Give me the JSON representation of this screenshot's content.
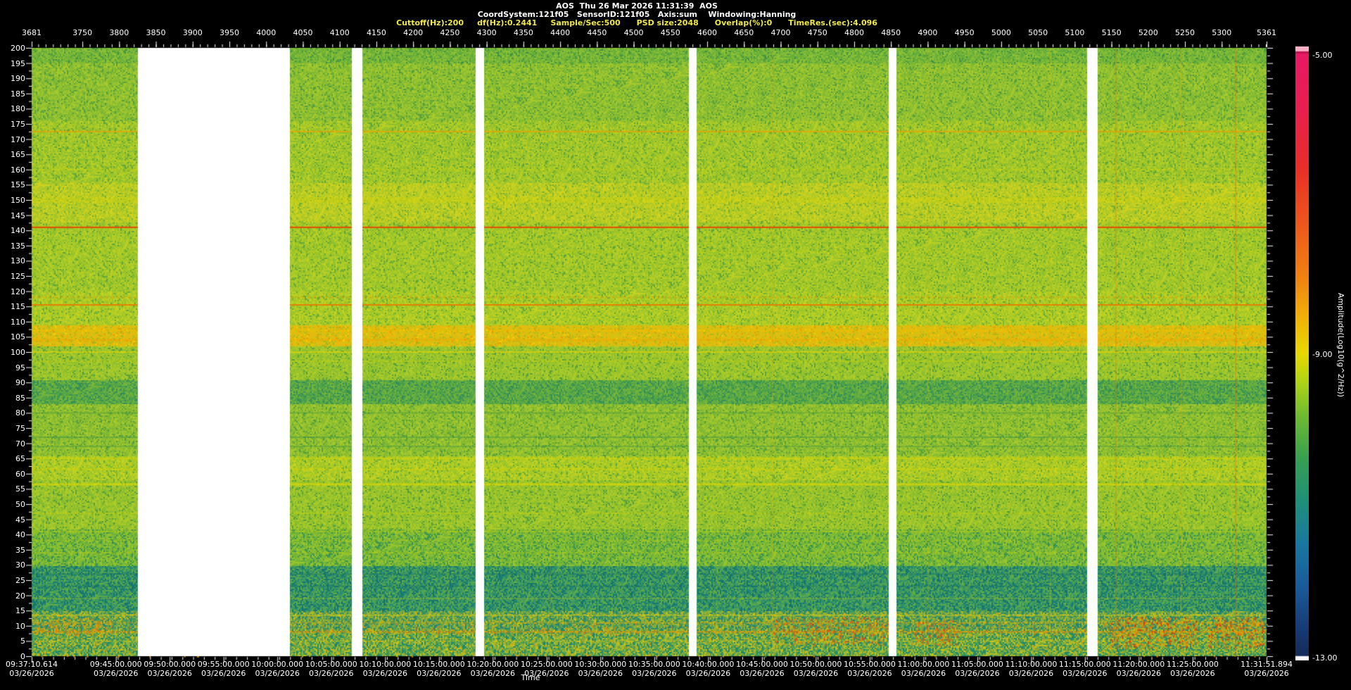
{
  "header": {
    "line1": "AOS  Thu 26 Mar 2026 11:31:39  AOS",
    "line2": "CoordSystem:121f05   SensorID:121f05   Axis:sum    Windowing:Hanning",
    "line3": "Cuttoff(Hz):200     df(Hz):0.2441     Sample/Sec:500      PSD size:2048      Overlap(%):0      TimeRes.(sec):4.096",
    "line3_color": "#f0e84a"
  },
  "chart_data": {
    "type": "heatmap",
    "subtype": "spectrogram",
    "title": "AOS  Thu 26 Mar 2026 11:31:39  AOS",
    "top_axis": {
      "range": [
        3681,
        5361
      ],
      "labels": [
        3681,
        3750,
        3800,
        3850,
        3900,
        3950,
        4000,
        4050,
        4100,
        4150,
        4200,
        4250,
        4300,
        4350,
        4400,
        4450,
        4500,
        4550,
        4600,
        4650,
        4700,
        4750,
        4800,
        4850,
        4900,
        4950,
        5000,
        5050,
        5100,
        5150,
        5200,
        5250,
        5300,
        5361
      ],
      "minor_tick_step": 10,
      "major_tick_step": 50
    },
    "y_axis": {
      "range": [
        0,
        200
      ],
      "labels": [
        200,
        195,
        190,
        185,
        180,
        175,
        170,
        165,
        160,
        155,
        150,
        145,
        140,
        135,
        130,
        125,
        120,
        115,
        110,
        105,
        100,
        95,
        90,
        85,
        80,
        75,
        70,
        65,
        60,
        55,
        50,
        45,
        40,
        35,
        30,
        25,
        20,
        15,
        10,
        5,
        0
      ],
      "minor_tick_step": 2.5,
      "major_tick_step": 5
    },
    "time_axis": {
      "title": "Time",
      "start": "09:37:10.614",
      "end": "11:31:51.894",
      "total_seconds": 6881.28,
      "labels": [
        {
          "time": "09:37:10.614",
          "date": "03/26/2026",
          "pos": 0
        },
        {
          "time": "09:45:00.000",
          "date": "03/26/2026",
          "pos": 0.0682
        },
        {
          "time": "09:50:00.000",
          "date": "03/26/2026",
          "pos": 0.1118
        },
        {
          "time": "09:55:00.000",
          "date": "03/26/2026",
          "pos": 0.1554
        },
        {
          "time": "10:00:00.000",
          "date": "03/26/2026",
          "pos": 0.199
        },
        {
          "time": "10:05:00.000",
          "date": "03/26/2026",
          "pos": 0.2426
        },
        {
          "time": "10:10:00.000",
          "date": "03/26/2026",
          "pos": 0.2862
        },
        {
          "time": "10:15:00.000",
          "date": "03/26/2026",
          "pos": 0.3298
        },
        {
          "time": "10:20:00.000",
          "date": "03/26/2026",
          "pos": 0.3734
        },
        {
          "time": "10:25:00.000",
          "date": "03/26/2026",
          "pos": 0.417
        },
        {
          "time": "10:30:00.000",
          "date": "03/26/2026",
          "pos": 0.4606
        },
        {
          "time": "10:35:00.000",
          "date": "03/26/2026",
          "pos": 0.5042
        },
        {
          "time": "10:40:00.000",
          "date": "03/26/2026",
          "pos": 0.5478
        },
        {
          "time": "10:45:00.000",
          "date": "03/26/2026",
          "pos": 0.5914
        },
        {
          "time": "10:50:00.000",
          "date": "03/26/2026",
          "pos": 0.635
        },
        {
          "time": "10:55:00.000",
          "date": "03/26/2026",
          "pos": 0.6786
        },
        {
          "time": "11:00:00.000",
          "date": "03/26/2026",
          "pos": 0.7222
        },
        {
          "time": "11:05:00.000",
          "date": "03/26/2026",
          "pos": 0.7658
        },
        {
          "time": "11:10:00.000",
          "date": "03/26/2026",
          "pos": 0.8094
        },
        {
          "time": "11:15:00.000",
          "date": "03/26/2026",
          "pos": 0.8529
        },
        {
          "time": "11:20:00.000",
          "date": "03/26/2026",
          "pos": 0.8965
        },
        {
          "time": "11:25:00.000",
          "date": "03/26/2026",
          "pos": 0.9401
        },
        {
          "time": "11:31:51.894",
          "date": "03/26/2026",
          "pos": 1.0
        }
      ]
    },
    "colorbar": {
      "labels": [
        "-5.00",
        "-9.00",
        "-13.00"
      ],
      "range": [
        -5.0,
        -13.0
      ],
      "title": "Amplitude(Log10(g^2/Hz))",
      "gradient": [
        {
          "p": 0.0,
          "c": "#ffaec8"
        },
        {
          "p": 0.007,
          "c": "#ffaec8"
        },
        {
          "p": 0.009,
          "c": "#b01048"
        },
        {
          "p": 0.013,
          "c": "#e81866"
        },
        {
          "p": 0.1,
          "c": "#e81e4e"
        },
        {
          "p": 0.2,
          "c": "#e82e28"
        },
        {
          "p": 0.3,
          "c": "#ee5c1a"
        },
        {
          "p": 0.38,
          "c": "#f08410"
        },
        {
          "p": 0.44,
          "c": "#f0b008"
        },
        {
          "p": 0.5,
          "c": "#e8d800"
        },
        {
          "p": 0.545,
          "c": "#b0d414"
        },
        {
          "p": 0.6,
          "c": "#70bc30"
        },
        {
          "p": 0.67,
          "c": "#38a050"
        },
        {
          "p": 0.74,
          "c": "#1e9078"
        },
        {
          "p": 0.81,
          "c": "#1878a0"
        },
        {
          "p": 0.88,
          "c": "#1a5a9a"
        },
        {
          "p": 0.96,
          "c": "#16366e"
        },
        {
          "p": 0.992,
          "c": "#142c58"
        },
        {
          "p": 0.994,
          "c": "#ffffff"
        },
        {
          "p": 1.0,
          "c": "#ffffff"
        }
      ]
    },
    "data_gaps": [
      {
        "x0": 0.086,
        "x1": 0.2091
      },
      {
        "x0": 0.2593,
        "x1": 0.2678
      },
      {
        "x0": 0.3595,
        "x1": 0.3664
      },
      {
        "x0": 0.5322,
        "x1": 0.5385
      },
      {
        "x0": 0.694,
        "x1": 0.7003
      },
      {
        "x0": 0.8547,
        "x1": 0.8632
      }
    ],
    "bands": [
      {
        "f0": 195,
        "f1": 201,
        "c1": "#5aa83c",
        "c2": "#96c432",
        "spk": 0.1,
        "spkc": "#3c8c46"
      },
      {
        "f0": 176,
        "f1": 195,
        "c1": "#74b436",
        "c2": "#aecc2a",
        "spk": 0.12,
        "spkc": "#4a9840"
      },
      {
        "f0": 156,
        "f1": 176,
        "c1": "#84bc30",
        "c2": "#c2d222",
        "spk": 0.1,
        "spkc": "#55a03c"
      },
      {
        "f0": 143,
        "f1": 156,
        "c1": "#9cc42a",
        "c2": "#d8d41c",
        "spk": 0.08,
        "spkc": "#6aa836"
      },
      {
        "f0": 120,
        "f1": 143,
        "c1": "#88be2e",
        "c2": "#c2d222",
        "spk": 0.1,
        "spkc": "#55a03c"
      },
      {
        "f0": 109,
        "f1": 120,
        "c1": "#90c22c",
        "c2": "#ccd41e",
        "spk": 0.1,
        "spkc": "#5aa43a"
      },
      {
        "f0": 102,
        "f1": 109,
        "c1": "#ccc414",
        "c2": "#f0b60c",
        "spk": 0.15,
        "spkc": "#a0b41e"
      },
      {
        "f0": 91,
        "f1": 102,
        "c1": "#84bc30",
        "c2": "#b6ce26",
        "spk": 0.12,
        "spkc": "#4a9840"
      },
      {
        "f0": 83,
        "f1": 91,
        "c1": "#3f9a50",
        "c2": "#7cb836",
        "spk": 0.15,
        "spkc": "#2e8860"
      },
      {
        "f0": 66,
        "f1": 83,
        "c1": "#76b434",
        "c2": "#aecc2a",
        "spk": 0.12,
        "spkc": "#4a9840"
      },
      {
        "f0": 58,
        "f1": 66,
        "c1": "#90c22c",
        "c2": "#ccd41e",
        "spk": 0.1,
        "spkc": "#5aa43a"
      },
      {
        "f0": 42,
        "f1": 58,
        "c1": "#80ba30",
        "c2": "#b6ce26",
        "spk": 0.12,
        "spkc": "#4a9840"
      },
      {
        "f0": 30,
        "f1": 42,
        "c1": "#60ac3c",
        "c2": "#a0c82c",
        "spk": 0.18,
        "spkc": "#2e8c5a"
      },
      {
        "f0": 15,
        "f1": 30,
        "c1": "#1e8876",
        "c2": "#68b040",
        "spk": 0.25,
        "spkc": "#14706e"
      },
      {
        "f0": 9,
        "f1": 15,
        "c1": "#2e9068",
        "c2": "#b4bc22",
        "spk": 0.2,
        "spkc": "#188078"
      },
      {
        "f0": 0,
        "f1": 9,
        "c1": "#38985c",
        "c2": "#ccc41a",
        "spk": 0.22,
        "spkc": "#1a8472"
      }
    ],
    "spectral_lines": [
      {
        "f": 172.5,
        "color": "#e8a400",
        "alpha": 0.75,
        "w": 2
      },
      {
        "f": 160,
        "color": "#d8d400",
        "alpha": 0.22,
        "w": 3
      },
      {
        "f": 150,
        "color": "#e0d800",
        "alpha": 0.25,
        "w": 8
      },
      {
        "f": 141,
        "color": "#e84400",
        "alpha": 0.95,
        "w": 2
      },
      {
        "f": 133,
        "color": "#c8d400",
        "alpha": 0.2,
        "w": 2
      },
      {
        "f": 118,
        "color": "#e89000",
        "alpha": 0.45,
        "w": 2,
        "dash": true
      },
      {
        "f": 115.5,
        "color": "#e87c00",
        "alpha": 0.95,
        "w": 2
      },
      {
        "f": 107,
        "color": "#f0c000",
        "alpha": 0.5,
        "w": 3
      },
      {
        "f": 104,
        "color": "#f0a800",
        "alpha": 0.5,
        "w": 3
      },
      {
        "f": 100,
        "color": "#e8d400",
        "alpha": 0.6,
        "w": 2
      },
      {
        "f": 97,
        "color": "#d8d400",
        "alpha": 0.3,
        "w": 2
      },
      {
        "f": 80,
        "color": "#3c9448",
        "alpha": 0.4,
        "w": 2
      },
      {
        "f": 72,
        "color": "#2e8c50",
        "alpha": 0.4,
        "w": 2
      },
      {
        "f": 69,
        "color": "#2e8c50",
        "alpha": 0.35,
        "w": 2
      },
      {
        "f": 65,
        "color": "#d8d400",
        "alpha": 0.55,
        "w": 2
      },
      {
        "f": 61.5,
        "color": "#d8d400",
        "alpha": 0.5,
        "w": 2
      },
      {
        "f": 56.5,
        "color": "#e0d800",
        "alpha": 0.65,
        "w": 3
      },
      {
        "f": 47,
        "color": "#d0d400",
        "alpha": 0.3,
        "w": 2
      },
      {
        "f": 41,
        "color": "#d0d400",
        "alpha": 0.35,
        "w": 2
      },
      {
        "f": 38,
        "color": "#d0d400",
        "alpha": 0.2,
        "w": 2
      },
      {
        "f": 34,
        "color": "#d0d400",
        "alpha": 0.25,
        "w": 2
      },
      {
        "f": 27,
        "color": "#156e6a",
        "alpha": 0.4,
        "w": 2
      },
      {
        "f": 23,
        "color": "#156e6a",
        "alpha": 0.4,
        "w": 2
      },
      {
        "f": 19,
        "color": "#bcc81e",
        "alpha": 0.3,
        "w": 2
      },
      {
        "f": 13.5,
        "color": "#d8cc14",
        "alpha": 0.55,
        "w": 2
      },
      {
        "f": 11,
        "color": "#e8a800",
        "alpha": 0.4,
        "w": 2
      },
      {
        "f": 8,
        "color": "#e89000",
        "alpha": 0.45,
        "w": 3
      },
      {
        "f": 5,
        "color": "#d8cc14",
        "alpha": 0.35,
        "w": 2
      }
    ],
    "speckle_bands": [
      {
        "f0": 7,
        "f1": 11,
        "colors": [
          "#f09800",
          "#e87010",
          "#e8c800"
        ],
        "density": 0.1
      },
      {
        "f0": 11,
        "f1": 14.5,
        "colors": [
          "#e8d000",
          "#f0b000"
        ],
        "density": 0.08
      },
      {
        "f0": 0,
        "f1": 6,
        "colors": [
          "#e8c800",
          "#f09800"
        ],
        "density": 0.06
      },
      {
        "f0": 102,
        "f1": 109,
        "colors": [
          "#ffd400",
          "#f09000"
        ],
        "density": 0.08
      }
    ],
    "hot_spots": [
      {
        "x0": 0.0,
        "x1": 0.066,
        "f0": 7,
        "f1": 13,
        "density": 0.18,
        "colors": [
          "#f08000",
          "#e8a800"
        ]
      },
      {
        "x0": 0.6,
        "x1": 0.695,
        "f0": 4,
        "f1": 13,
        "density": 0.22,
        "colors": [
          "#e84810",
          "#f07800",
          "#f0a800"
        ]
      },
      {
        "x0": 0.715,
        "x1": 0.75,
        "f0": 4,
        "f1": 12,
        "density": 0.2,
        "colors": [
          "#e84810",
          "#f07800"
        ]
      },
      {
        "x0": 0.873,
        "x1": 0.944,
        "f0": 3,
        "f1": 13,
        "density": 0.3,
        "colors": [
          "#e03808",
          "#f07800",
          "#f0a800"
        ]
      },
      {
        "x0": 0.952,
        "x1": 0.998,
        "f0": 3,
        "f1": 13,
        "density": 0.3,
        "colors": [
          "#e03808",
          "#f07800",
          "#f0a800"
        ]
      }
    ],
    "v_streaks": [
      {
        "x": 0.337,
        "color": "#d8d400",
        "alpha": 0.18,
        "w": 2,
        "f0": 0,
        "f1": 60
      },
      {
        "x": 0.42,
        "color": "#e8b000",
        "alpha": 0.15,
        "w": 2,
        "f0": 0,
        "f1": 45
      },
      {
        "x": 0.555,
        "color": "#d8d400",
        "alpha": 0.15,
        "w": 2,
        "f0": 0,
        "f1": 50
      },
      {
        "x": 0.6,
        "color": "#e8a000",
        "alpha": 0.2,
        "w": 2,
        "f0": 0,
        "f1": 200
      },
      {
        "x": 0.726,
        "color": "#e8b000",
        "alpha": 0.18,
        "w": 2,
        "f0": 0,
        "f1": 200
      },
      {
        "x": 0.825,
        "color": "#e8c000",
        "alpha": 0.22,
        "w": 2,
        "f0": 0,
        "f1": 200
      },
      {
        "x": 0.878,
        "color": "#e87800",
        "alpha": 0.3,
        "w": 2,
        "f0": 0,
        "f1": 200
      },
      {
        "x": 0.931,
        "color": "#e8a000",
        "alpha": 0.25,
        "w": 2,
        "f0": 0,
        "f1": 200
      },
      {
        "x": 0.975,
        "color": "#e86000",
        "alpha": 0.3,
        "w": 2,
        "f0": 0,
        "f1": 200
      }
    ]
  }
}
